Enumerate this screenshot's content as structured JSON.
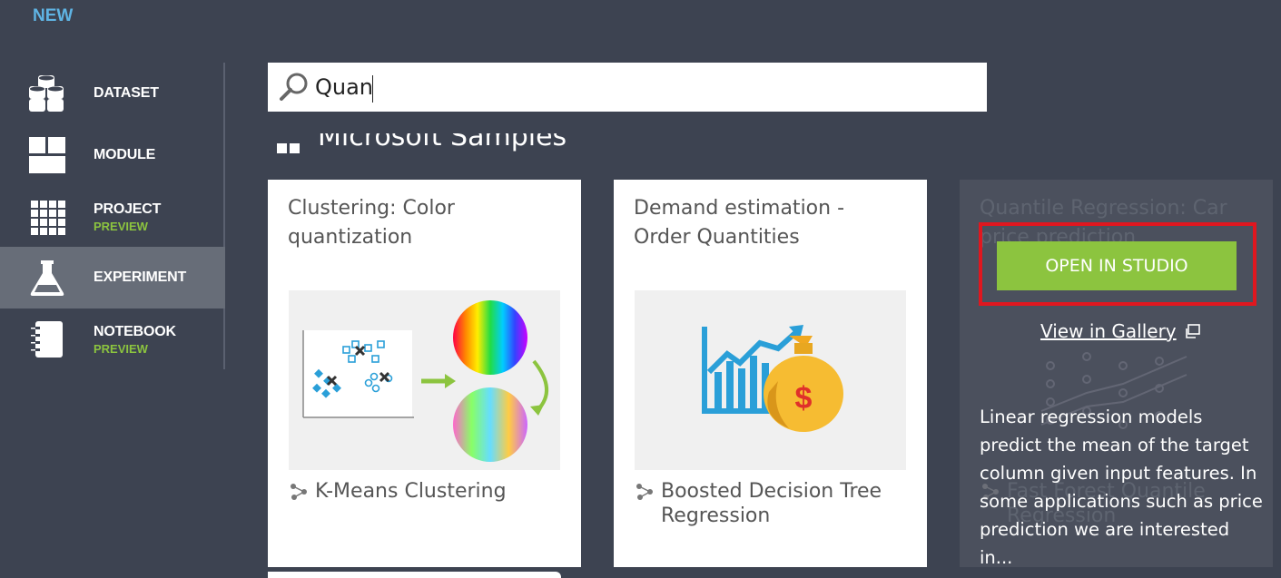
{
  "header": {
    "new_label": "NEW"
  },
  "nav": {
    "items": [
      {
        "label": "DATASET",
        "sub": "",
        "icon": "dataset-icon"
      },
      {
        "label": "MODULE",
        "sub": "",
        "icon": "module-icon"
      },
      {
        "label": "PROJECT",
        "sub": "PREVIEW",
        "icon": "project-icon"
      },
      {
        "label": "EXPERIMENT",
        "sub": "",
        "icon": "experiment-icon",
        "active": true
      },
      {
        "label": "NOTEBOOK",
        "sub": "PREVIEW",
        "icon": "notebook-icon"
      }
    ]
  },
  "search": {
    "value": "Quan",
    "placeholder": ""
  },
  "section": {
    "heading": "Microsoft Samples"
  },
  "cards": [
    {
      "title": "Clustering: Color quantization",
      "module": "K-Means Clustering",
      "image": "clustering-illustration"
    },
    {
      "title": "Demand estimation - Order Quantities",
      "module": "Boosted Decision Tree Regression",
      "image": "demand-estimation-illustration"
    }
  ],
  "preview": {
    "title": "Quantile Regression: Car price prediction",
    "footer": "Fast Forest Quantile Regression",
    "open_button": "OPEN IN STUDIO",
    "gallery_link": "View in Gallery",
    "description": "Linear regression models predict the mean of the target column given input features. In some applications such as price prediction we are interested in..."
  },
  "colors": {
    "background": "#3d4351",
    "accent_blue": "#5fb4e4",
    "accent_green": "#8cc43f",
    "highlight_red": "#e0171f"
  }
}
